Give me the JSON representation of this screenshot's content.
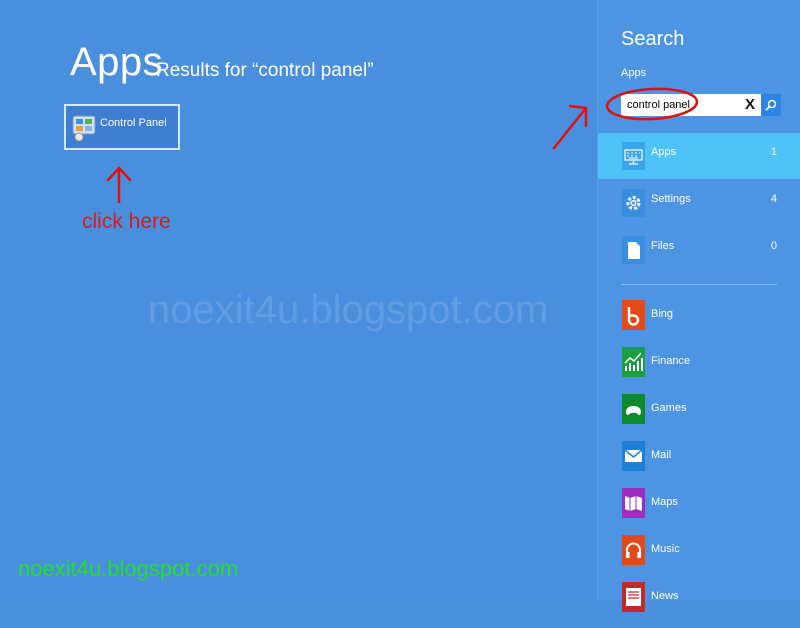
{
  "main": {
    "title": "Apps",
    "results_label": "Results for “control panel”",
    "result_tile": {
      "label": "Control Panel",
      "icon": "control-panel-icon"
    },
    "annotation_text": "click here",
    "watermark": "noexit4u.blogspot.com"
  },
  "footer_watermark": "noexit4u.blogspot.com",
  "charm": {
    "title": "Search",
    "scope": "Apps",
    "search": {
      "value": "control panel",
      "clear": "X"
    },
    "categories": [
      {
        "label": "Apps",
        "count": "1",
        "icon": "apps-keyboard-icon",
        "selected": true
      },
      {
        "label": "Settings",
        "count": "4",
        "icon": "gear-icon"
      },
      {
        "label": "Files",
        "count": "0",
        "icon": "file-icon"
      }
    ],
    "apps": [
      {
        "label": "Bing",
        "icon": "bing-icon",
        "color": "#e64a19"
      },
      {
        "label": "Finance",
        "icon": "finance-chart-icon",
        "color": "#1b9e3e"
      },
      {
        "label": "Games",
        "icon": "gamepad-icon",
        "color": "#0e8a2c"
      },
      {
        "label": "Mail",
        "icon": "mail-icon",
        "color": "#1f7fd6"
      },
      {
        "label": "Maps",
        "icon": "map-icon",
        "color": "#9b2dbf"
      },
      {
        "label": "Music",
        "icon": "headphones-icon",
        "color": "#e2491b"
      },
      {
        "label": "News",
        "icon": "news-icon",
        "color": "#c62828"
      }
    ]
  },
  "colors": {
    "background": "#4a8fde",
    "charm_bg": "#4d95e3",
    "selected_row": "#4fc3f7",
    "annotation": "#d81b1b",
    "watermark_green": "#22e02b"
  }
}
